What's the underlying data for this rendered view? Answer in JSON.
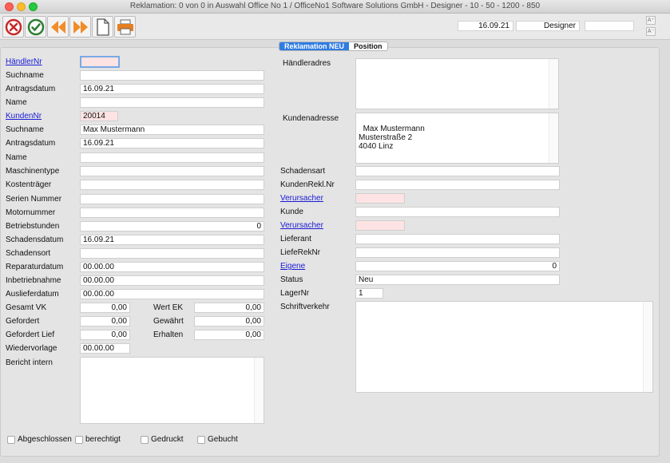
{
  "window": {
    "title": "Reklamation: 0 von 0 in Auswahl Office No 1 /  OfficeNo1 Software Solutions GmbH - Designer - 10 - 50 - 1200 - 850"
  },
  "toolbar": {
    "icons": [
      "cancel-icon",
      "confirm-icon",
      "previous-icon",
      "next-icon",
      "new-document-icon",
      "print-icon"
    ],
    "date": "16.09.21",
    "user": "Designer",
    "empty": "",
    "font_up": "A⁺",
    "font_down": "A⁻"
  },
  "tabs": [
    {
      "label": "Reklamation NEU",
      "active": true
    },
    {
      "label": "Position",
      "active": false
    }
  ],
  "left": {
    "haendlernr_label": "HändlerNr",
    "haendlernr": "",
    "suchname1_label": "Suchname",
    "suchname1": "",
    "antragsdatum1_label": "Antragsdatum",
    "antragsdatum1": "16.09.21",
    "name1_label": "Name",
    "name1": "",
    "kundennr_label": "KundenNr",
    "kundennr": "20014",
    "suchname2_label": "Suchname",
    "suchname2": "Max Mustermann",
    "antragsdatum2_label": "Antragsdatum",
    "antragsdatum2": "16.09.21",
    "name2_label": "Name",
    "name2": "",
    "maschinentype_label": "Maschinentype",
    "maschinentype": "",
    "kostentraeger_label": "Kostenträger",
    "kostentraeger": "",
    "seriennummer_label": "Serien Nummer",
    "seriennummer": "",
    "motornummer_label": "Motornummer",
    "motornummer": "",
    "betriebsstunden_label": "Betriebstunden",
    "betriebsstunden": "0",
    "schadensdatum_label": "Schadensdatum",
    "schadensdatum": "16.09.21",
    "schadensort_label": "Schadensort",
    "schadensort": "",
    "reparaturdatum_label": "Reparaturdatum",
    "reparaturdatum": "00.00.00",
    "inbetriebnahme_label": "Inbetriebnahme",
    "inbetriebnahme": "00.00.00",
    "auslieferdatum_label": "Auslieferdatum",
    "auslieferdatum": "00.00.00",
    "gesamtvk_label": "Gesamt VK",
    "gesamtvk": "0,00",
    "gefordert_label": "Gefordert",
    "gefordert": "0,00",
    "gefordertlief_label": "Gefordert Lief",
    "gefordertlief": "0,00",
    "wertek_label": "Wert EK",
    "wertek": "0,00",
    "gewaehrt_label": "Gewährt",
    "gewaehrt": "0,00",
    "erhalten_label": "Erhalten",
    "erhalten": "0,00",
    "wiedervorlage_label": "Wiedervorlage",
    "wiedervorlage": "00.00.00",
    "bericht_label": "Bericht intern",
    "bericht": ""
  },
  "right": {
    "haendleradresse_label": "Händleradres",
    "haendleradresse": "",
    "kundenadresse_label": "Kundenadresse",
    "kundenadresse": "Max Mustermann\nMusterstraße 2\n4040 Linz",
    "schadensart_label": "Schadensart",
    "schadensart": "",
    "kundenrekl_label": "KundenRekl.Nr",
    "kundenrekl": "",
    "verursacher1_label": "Verursacher",
    "verursacher1": "",
    "kunde_label": "Kunde",
    "kunde": "",
    "verursacher2_label": "Verursacher",
    "verursacher2": "",
    "lieferant_label": "Lieferant",
    "lieferant": "",
    "lieferekn_label": "LiefeRekNr",
    "lieferekn": "",
    "eigene_label": "Eigene",
    "eigene": "0",
    "status_label": "Status",
    "status": "Neu",
    "lagernr_label": "LagerNr",
    "lagernr": "1",
    "schriftverkehr_label": "Schriftverkehr",
    "schriftverkehr": ""
  },
  "checkboxes": [
    {
      "label": "Abgeschlossen",
      "checked": false
    },
    {
      "label": "berechtigt",
      "checked": false
    },
    {
      "label": "Gedruckt",
      "checked": false
    },
    {
      "label": "Gebucht",
      "checked": false
    }
  ]
}
